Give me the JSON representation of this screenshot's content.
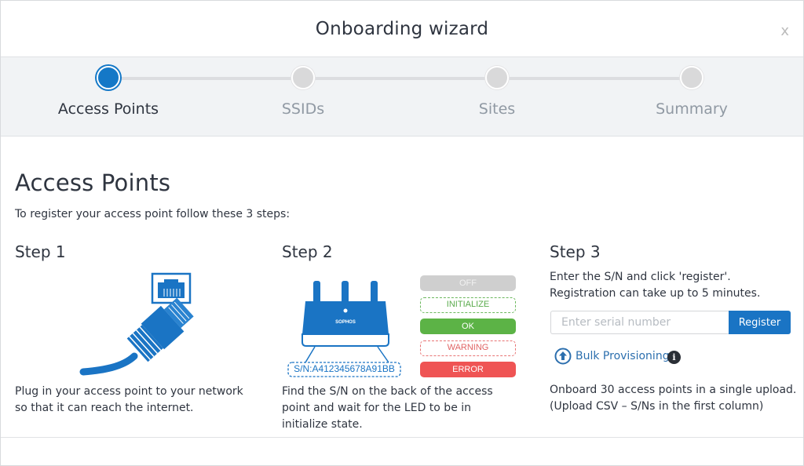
{
  "dialog": {
    "title": "Onboarding wizard",
    "close_label": "x"
  },
  "wizard": {
    "steps": [
      {
        "label": "Access Points",
        "active": true
      },
      {
        "label": "SSIDs",
        "active": false
      },
      {
        "label": "Sites",
        "active": false
      },
      {
        "label": "Summary",
        "active": false
      }
    ]
  },
  "main": {
    "heading": "Access Points",
    "intro": "To register your access point follow these 3 steps:",
    "step1": {
      "title": "Step 1",
      "illustration": "ethernet-cable-icon",
      "description": "Plug in your access point to your network so that it can reach the internet."
    },
    "step2": {
      "title": "Step 2",
      "illustration": "access-point-device",
      "device_brand": "SOPHOS",
      "serial_label": "S/N:A412345678A91BB",
      "led_states": [
        "OFF",
        "INITIALIZE",
        "OK",
        "WARNING",
        "ERROR"
      ],
      "description": "Find the S/N on the back of the access point and wait for the LED to be in initialize state."
    },
    "step3": {
      "title": "Step 3",
      "description": "Enter the S/N and click 'register'. Registration can take up to 5 minutes.",
      "serial_input": {
        "value": "",
        "placeholder": "Enter serial number"
      },
      "register_label": "Register",
      "bulk_label": "Bulk Provisioning",
      "info_label": "i",
      "bulk_description": "Onboard 30 access points in a single upload. (Upload CSV – S/Ns in the first column)"
    }
  },
  "colors": {
    "accent": "#1a74c4",
    "ok": "#5cb346",
    "error": "#ef5454",
    "warning": "#e06464",
    "off": "#cfcfcf"
  }
}
